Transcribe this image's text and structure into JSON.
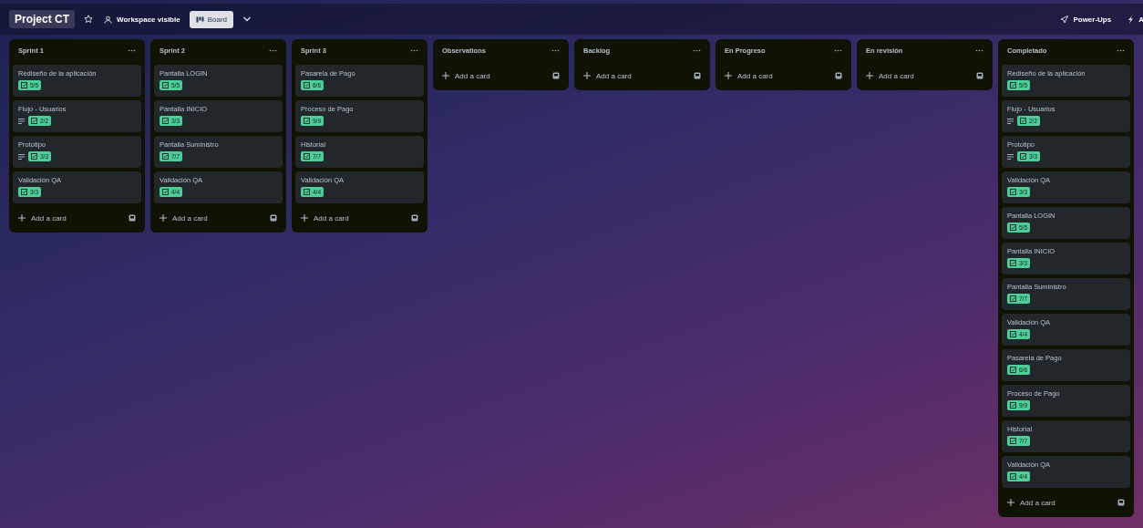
{
  "header": {
    "board_title": "Project CT",
    "starred": false,
    "visibility": "Workspace visible",
    "view": {
      "label": "Board",
      "selected": true
    },
    "right_items": [
      {
        "kind": "powerups",
        "label": "Power-Ups"
      },
      {
        "kind": "automation",
        "label": "A"
      }
    ]
  },
  "lists": [
    {
      "title": "Sprint 1",
      "add_label": "Add a card",
      "cards": [
        {
          "title": "Rediseño de la aplicación",
          "has_description": false,
          "checklist": "5/5",
          "complete": true
        },
        {
          "title": "Flujo - Usuarios",
          "has_description": true,
          "checklist": "2/2",
          "complete": true
        },
        {
          "title": "Prototipo",
          "has_description": true,
          "checklist": "3/3",
          "complete": true
        },
        {
          "title": "Validación QA",
          "has_description": false,
          "checklist": "3/3",
          "complete": true
        }
      ]
    },
    {
      "title": "Sprint 2",
      "add_label": "Add a card",
      "cards": [
        {
          "title": "Pantalla LOGIN",
          "has_description": false,
          "checklist": "5/5",
          "complete": true
        },
        {
          "title": "Pantalla INICIO",
          "has_description": false,
          "checklist": "3/3",
          "complete": true
        },
        {
          "title": "Pantalla Suministro",
          "has_description": false,
          "checklist": "7/7",
          "complete": true
        },
        {
          "title": "Validación QA",
          "has_description": false,
          "checklist": "4/4",
          "complete": true
        }
      ]
    },
    {
      "title": "Sprint 3",
      "add_label": "Add a card",
      "cards": [
        {
          "title": "Pasarela de Pago",
          "has_description": false,
          "checklist": "6/6",
          "complete": true
        },
        {
          "title": "Proceso de Pago",
          "has_description": false,
          "checklist": "9/9",
          "complete": true
        },
        {
          "title": "Historial",
          "has_description": false,
          "checklist": "7/7",
          "complete": true
        },
        {
          "title": "Validación QA",
          "has_description": false,
          "checklist": "4/4",
          "complete": true
        }
      ]
    },
    {
      "title": "Observations",
      "add_label": "Add a card"
    },
    {
      "title": "Backlog",
      "add_label": "Add a card"
    },
    {
      "title": "En Progreso",
      "add_label": "Add a card"
    },
    {
      "title": "En revisión",
      "add_label": "Add a card"
    },
    {
      "title": "Completado",
      "add_label": "Add a card",
      "cards": [
        {
          "title": "Rediseño de la aplicación",
          "has_description": false,
          "checklist": "5/5",
          "complete": true
        },
        {
          "title": "Flujo - Usuarios",
          "has_description": true,
          "checklist": "2/2",
          "complete": true
        },
        {
          "title": "Prototipo",
          "has_description": true,
          "checklist": "3/3",
          "complete": true
        },
        {
          "title": "Validación QA",
          "has_description": false,
          "checklist": "3/3",
          "complete": true
        },
        {
          "title": "Pantalla LOGIN",
          "has_description": false,
          "checklist": "5/5",
          "complete": true
        },
        {
          "title": "Pantalla INICIO",
          "has_description": false,
          "checklist": "3/3",
          "complete": true
        },
        {
          "title": "Pantalla Suministro",
          "has_description": false,
          "checklist": "7/7",
          "complete": true
        },
        {
          "title": "Validación QA",
          "has_description": false,
          "checklist": "4/4",
          "complete": true
        },
        {
          "title": "Pasarela de Pago",
          "has_description": false,
          "checklist": "6/6",
          "complete": true
        },
        {
          "title": "Proceso de Pago",
          "has_description": false,
          "checklist": "9/9",
          "complete": true
        },
        {
          "title": "Historial",
          "has_description": false,
          "checklist": "7/7",
          "complete": true
        },
        {
          "title": "Validación QA",
          "has_description": false,
          "checklist": "4/4",
          "complete": true
        }
      ]
    }
  ]
}
